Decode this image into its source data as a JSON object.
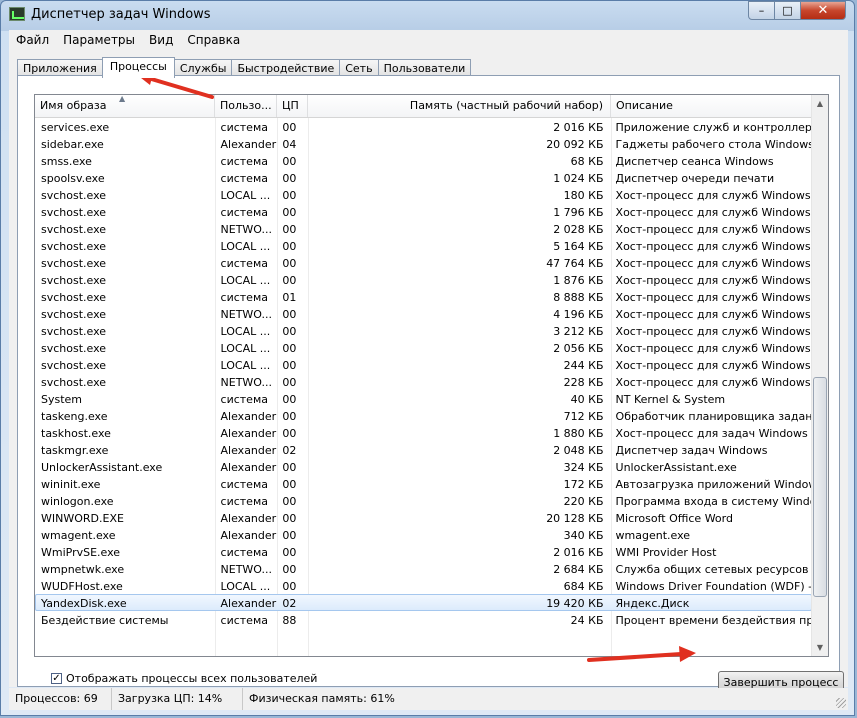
{
  "window": {
    "title": "Диспетчер задач Windows",
    "close_glyph": "✕",
    "min_glyph": "–",
    "max_glyph": "□"
  },
  "menu": [
    "Файл",
    "Параметры",
    "Вид",
    "Справка"
  ],
  "tabs": [
    "Приложения",
    "Процессы",
    "Службы",
    "Быстродействие",
    "Сеть",
    "Пользователи"
  ],
  "active_tab": 1,
  "columns": [
    "Имя образа",
    "Пользо...",
    "ЦП",
    "Память (частный рабочий набор)",
    "Описание"
  ],
  "processes": [
    [
      "services.exe",
      "система",
      "00",
      "2 016 КБ",
      "Приложение служб и контроллеров"
    ],
    [
      "sidebar.exe",
      "Alexander",
      "04",
      "20 092 КБ",
      "Гаджеты рабочего стола Windows"
    ],
    [
      "smss.exe",
      "система",
      "00",
      "68 КБ",
      "Диспетчер сеанса  Windows"
    ],
    [
      "spoolsv.exe",
      "система",
      "00",
      "1 024 КБ",
      "Диспетчер очереди печати"
    ],
    [
      "svchost.exe",
      "LOCAL ...",
      "00",
      "180 КБ",
      "Хост-процесс для служб Windows"
    ],
    [
      "svchost.exe",
      "система",
      "00",
      "1 796 КБ",
      "Хост-процесс для служб Windows"
    ],
    [
      "svchost.exe",
      "NETWO...",
      "00",
      "2 028 КБ",
      "Хост-процесс для служб Windows"
    ],
    [
      "svchost.exe",
      "LOCAL ...",
      "00",
      "5 164 КБ",
      "Хост-процесс для служб Windows"
    ],
    [
      "svchost.exe",
      "система",
      "00",
      "47 764 КБ",
      "Хост-процесс для служб Windows"
    ],
    [
      "svchost.exe",
      "LOCAL ...",
      "00",
      "1 876 КБ",
      "Хост-процесс для служб Windows"
    ],
    [
      "svchost.exe",
      "система",
      "01",
      "8 888 КБ",
      "Хост-процесс для служб Windows"
    ],
    [
      "svchost.exe",
      "NETWO...",
      "00",
      "4 196 КБ",
      "Хост-процесс для служб Windows"
    ],
    [
      "svchost.exe",
      "LOCAL ...",
      "00",
      "3 212 КБ",
      "Хост-процесс для служб Windows"
    ],
    [
      "svchost.exe",
      "LOCAL ...",
      "00",
      "2 056 КБ",
      "Хост-процесс для служб Windows"
    ],
    [
      "svchost.exe",
      "LOCAL ...",
      "00",
      "244 КБ",
      "Хост-процесс для служб Windows"
    ],
    [
      "svchost.exe",
      "NETWO...",
      "00",
      "228 КБ",
      "Хост-процесс для служб Windows"
    ],
    [
      "System",
      "система",
      "00",
      "40 КБ",
      "NT Kernel & System"
    ],
    [
      "taskeng.exe",
      "Alexander",
      "00",
      "712 КБ",
      "Обработчик планировщика заданий"
    ],
    [
      "taskhost.exe",
      "Alexander",
      "00",
      "1 880 КБ",
      "Хост-процесс для задач Windows"
    ],
    [
      "taskmgr.exe",
      "Alexander",
      "02",
      "2 048 КБ",
      "Диспетчер задач Windows"
    ],
    [
      "UnlockerAssistant.exe",
      "Alexander",
      "00",
      "324 КБ",
      "UnlockerAssistant.exe"
    ],
    [
      "wininit.exe",
      "система",
      "00",
      "172 КБ",
      "Автозагрузка приложений Windows"
    ],
    [
      "winlogon.exe",
      "система",
      "00",
      "220 КБ",
      "Программа входа в систему Windows"
    ],
    [
      "WINWORD.EXE",
      "Alexander",
      "00",
      "20 128 КБ",
      "Microsoft Office Word"
    ],
    [
      "wmagent.exe",
      "Alexander",
      "00",
      "340 КБ",
      "wmagent.exe"
    ],
    [
      "WmiPrvSE.exe",
      "система",
      "00",
      "2 016 КБ",
      "WMI Provider Host"
    ],
    [
      "wmpnetwk.exe",
      "NETWO...",
      "00",
      "2 684 КБ",
      "Служба общих сетевых ресурсов пр..."
    ],
    [
      "WUDFHost.exe",
      "LOCAL ...",
      "00",
      "684 КБ",
      "Windows Driver Foundation (WDF) - х..."
    ],
    [
      "YandexDisk.exe",
      "Alexander",
      "02",
      "19 420 КБ",
      "Яндекс.Диск"
    ],
    [
      "Бездействие системы",
      "система",
      "88",
      "24 КБ",
      "Процент времени бездействия проц..."
    ]
  ],
  "selected_row": 28,
  "show_all_users": {
    "label": "Отображать процессы всех пользователей",
    "checked": true,
    "check_glyph": "✓"
  },
  "end_process_label": "Завершить процесс",
  "status": {
    "processes": "Процессов: 69",
    "cpu": "Загрузка ЦП: 14%",
    "memory": "Физическая память: 61%"
  },
  "scroll_glyphs": {
    "up": "▲",
    "down": "▼",
    "sort": "▲"
  },
  "colors": {
    "accent_arrow": "#e03020",
    "selection_border": "#a5c7ee",
    "close_button": "#c7462c"
  }
}
